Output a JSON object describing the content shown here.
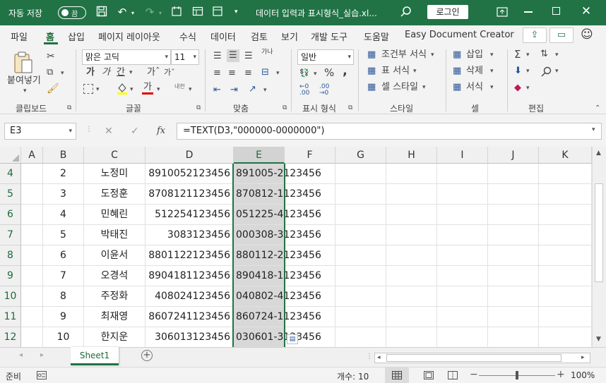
{
  "titlebar": {
    "autosave_label": "자동 저장",
    "autosave_state": "끔",
    "file_title": "데이터 입력과 표시형식_실습.xl...",
    "login_label": "로그인"
  },
  "menu": {
    "tabs": [
      "파일",
      "홈",
      "삽입",
      "페이지 레이아웃",
      "수식",
      "데이터",
      "검토",
      "보기",
      "개발 도구",
      "도움말",
      "Easy Document Creator"
    ],
    "active_tab": "홈"
  },
  "ribbon": {
    "clipboard": {
      "paste_label": "붙여넣기",
      "group_label": "클립보드"
    },
    "font": {
      "font_name": "맑은 고딕",
      "font_size": "11",
      "group_label": "글꼴",
      "bold": "가",
      "italic": "가",
      "underline": "간",
      "grow": "가ˆ",
      "shrink": "가ˇ",
      "phonetic": "내천",
      "font_color_letter": "가",
      "fill_color": "#ffff00",
      "font_color": "#e00000"
    },
    "alignment": {
      "group_label": "맞춤",
      "wrap": "가나"
    },
    "number": {
      "format_value": "일반",
      "group_label": "표시 형식"
    },
    "styles": {
      "conditional": "조건부 서식",
      "table": "표 서식",
      "cell_styles": "셀 스타일",
      "group_label": "스타일"
    },
    "cells": {
      "insert": "삽입",
      "delete": "삭제",
      "format": "서식",
      "group_label": "셀"
    },
    "editing": {
      "group_label": "편집"
    }
  },
  "formula_bar": {
    "name_box": "E3",
    "formula": "=TEXT(D3,\"000000-0000000\")"
  },
  "grid": {
    "columns": [
      "A",
      "B",
      "C",
      "D",
      "E",
      "F",
      "G",
      "H",
      "I",
      "J",
      "K"
    ],
    "selected_column": "E",
    "rows": [
      {
        "row": "4",
        "num": "2",
        "name": "노정미",
        "raw": "8910052123456",
        "formatted": "891005-2123456"
      },
      {
        "row": "5",
        "num": "3",
        "name": "도정훈",
        "raw": "8708121123456",
        "formatted": "870812-1123456"
      },
      {
        "row": "6",
        "num": "4",
        "name": "민혜린",
        "raw": "512254123456",
        "formatted": "051225-4123456"
      },
      {
        "row": "7",
        "num": "5",
        "name": "박태진",
        "raw": "3083123456",
        "formatted": "000308-3123456"
      },
      {
        "row": "8",
        "num": "6",
        "name": "이윤서",
        "raw": "8801122123456",
        "formatted": "880112-2123456"
      },
      {
        "row": "9",
        "num": "7",
        "name": "오경석",
        "raw": "8904181123456",
        "formatted": "890418-1123456"
      },
      {
        "row": "10",
        "num": "8",
        "name": "주정화",
        "raw": "408024123456",
        "formatted": "040802-4123456"
      },
      {
        "row": "11",
        "num": "9",
        "name": "최재영",
        "raw": "8607241123456",
        "formatted": "860724-1123456"
      },
      {
        "row": "12",
        "num": "10",
        "name": "한지운",
        "raw": "306013123456",
        "formatted": "030601-3123456"
      }
    ]
  },
  "sheets": {
    "tabs": [
      "Sheet1"
    ],
    "active": "Sheet1"
  },
  "status": {
    "ready": "준비",
    "count": "개수: 10",
    "zoom": "100%"
  },
  "colors": {
    "accent": "#217346",
    "selection_fill": "#d8d8d8"
  }
}
